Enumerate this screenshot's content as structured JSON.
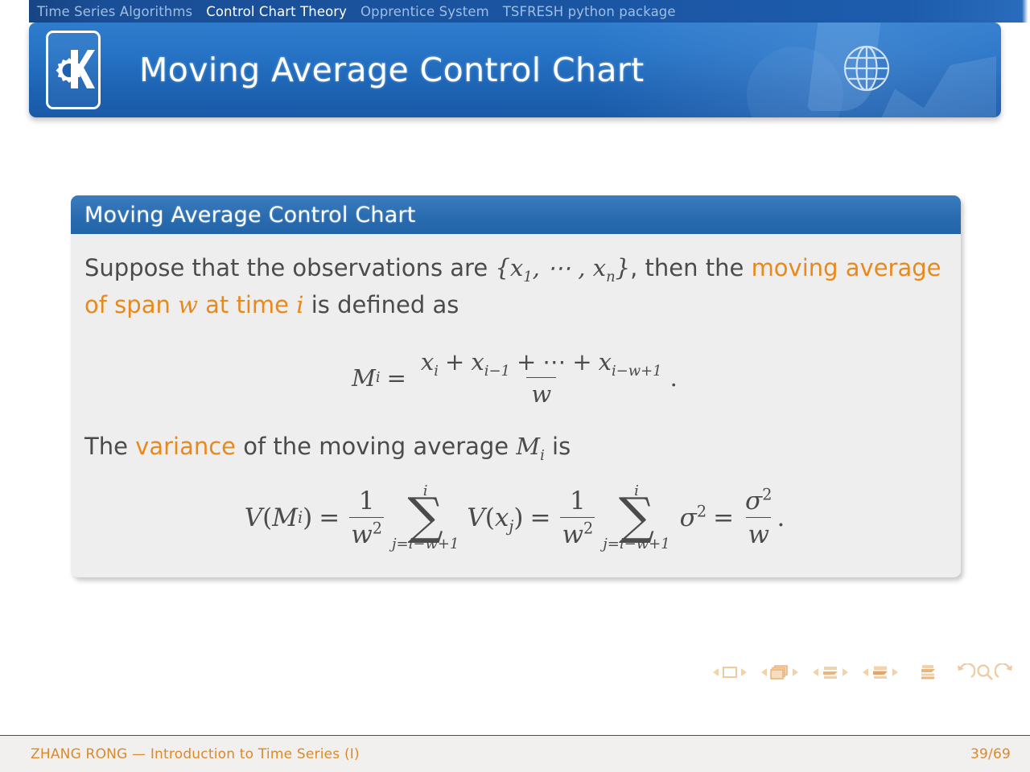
{
  "navbar": {
    "items": [
      {
        "label": "Time Series Algorithms",
        "active": false
      },
      {
        "label": "Control Chart Theory",
        "active": true
      },
      {
        "label": "Opprentice System",
        "active": false
      },
      {
        "label": "TSFRESH python package",
        "active": false
      }
    ]
  },
  "header": {
    "title": "Moving Average Control Chart",
    "logo_icon": "kde-k-gear-logo",
    "right_icon": "globe-icon"
  },
  "block": {
    "title": "Moving Average Control Chart",
    "paragraph1": {
      "part1": "Suppose that the observations are ",
      "set_open": "{",
      "set_x1": "x",
      "set_x1_sub": "1",
      "set_dots": ", ⋯ , ",
      "set_xn": "x",
      "set_xn_sub": "n",
      "set_close": "}",
      "part2": ", then the ",
      "highlight": "moving average of span w at time i",
      "highlight_w": "w",
      "highlight_i": "i",
      "highlight_pre": "moving average of span ",
      "highlight_mid": " at time ",
      "part3": " is defined as"
    },
    "equation1": {
      "lhs_M": "M",
      "lhs_sub": "i",
      "equals": "=",
      "num_x1": "x",
      "num_x1_sub": "i",
      "num_plus1": "+",
      "num_x2": "x",
      "num_x2_sub": "i−1",
      "num_plus2": "+",
      "num_dots": "⋯",
      "num_plus3": "+",
      "num_x3": "x",
      "num_x3_sub": "i−w+1",
      "den": "w",
      "period": "."
    },
    "paragraph2": {
      "part1": "The ",
      "highlight": "variance",
      "part2": " of the moving average ",
      "M": "M",
      "M_sub": "i",
      "part3": " is"
    },
    "equation2": {
      "V1": "V",
      "V1_open": "(",
      "V1_M": "M",
      "V1_sub": "i",
      "V1_close": ")",
      "equals1": "=",
      "frac1_num": "1",
      "frac1_den": "w",
      "frac1_den_sup": "2",
      "sigma_symbol": "∑",
      "sum1_top": "i",
      "sum1_bot": "j=i−w+1",
      "V2": "V",
      "V2_open": "(",
      "V2_x": "x",
      "V2_sub": "j",
      "V2_close": ")",
      "equals2": "=",
      "frac2_num": "1",
      "frac2_den": "w",
      "frac2_den_sup": "2",
      "sum2_top": "i",
      "sum2_bot": "j=i−w+1",
      "sigma_var": "σ",
      "sigma_var_sup": "2",
      "equals3": "=",
      "frac3_num": "σ",
      "frac3_num_sup": "2",
      "frac3_den": "w",
      "period": "."
    }
  },
  "nav_symbols": [
    "first-slide-icon",
    "prev-slide-icon",
    "slide-icon",
    "next-slide-icon",
    "prev-frame-icon",
    "frame-icon",
    "next-frame-icon",
    "prev-subsection-icon",
    "subsection-icon",
    "next-subsection-icon",
    "prev-section-icon",
    "section-icon",
    "next-section-icon",
    "document-icon",
    "back-icon",
    "search-icon",
    "forward-icon"
  ],
  "footer": {
    "author_title": "ZHANG RONG — Introduction to Time Series (I)",
    "page": "39/69"
  },
  "colors": {
    "accent_orange": "#d98a2b",
    "highlight_orange": "#e8891b",
    "banner_blue": "#2a6cb0",
    "nav_blue": "#1b55a2",
    "block_body": "#eeeeee",
    "text_gray": "#4b4b4b"
  }
}
